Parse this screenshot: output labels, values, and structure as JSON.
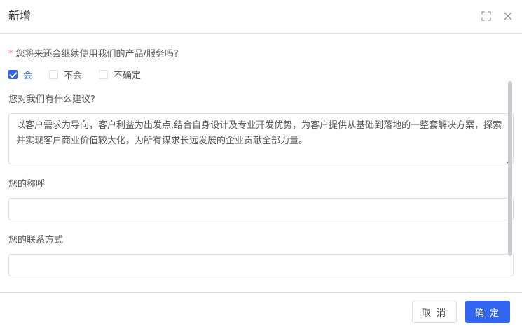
{
  "dialog": {
    "title": "新增",
    "icons": {
      "maximize": "maximize-icon",
      "close": "close-icon"
    }
  },
  "form": {
    "q1": {
      "required_mark": "*",
      "label": "您将来还会继续使用我们的产品/服务吗?",
      "options": [
        {
          "label": "会",
          "checked": true
        },
        {
          "label": "不会",
          "checked": false
        },
        {
          "label": "不确定",
          "checked": false
        }
      ]
    },
    "q2": {
      "label": "您对我们有什么建议?",
      "value": "以客户需求为导向，客户利益为出发点,结合自身设计及专业开发优势，为客户提供从基础到落地的一整套解决方案，探索并实现客户商业价值较大化，为所有谋求长远发展的企业贡献全部力量。"
    },
    "q3": {
      "label": "您的称呼",
      "value": ""
    },
    "q4": {
      "label": "您的联系方式",
      "value": ""
    }
  },
  "footer": {
    "cancel_label": "取 消",
    "ok_label": "确 定"
  },
  "colors": {
    "primary": "#3366ee",
    "required": "#f56c6c",
    "border": "#dcdfe6"
  }
}
